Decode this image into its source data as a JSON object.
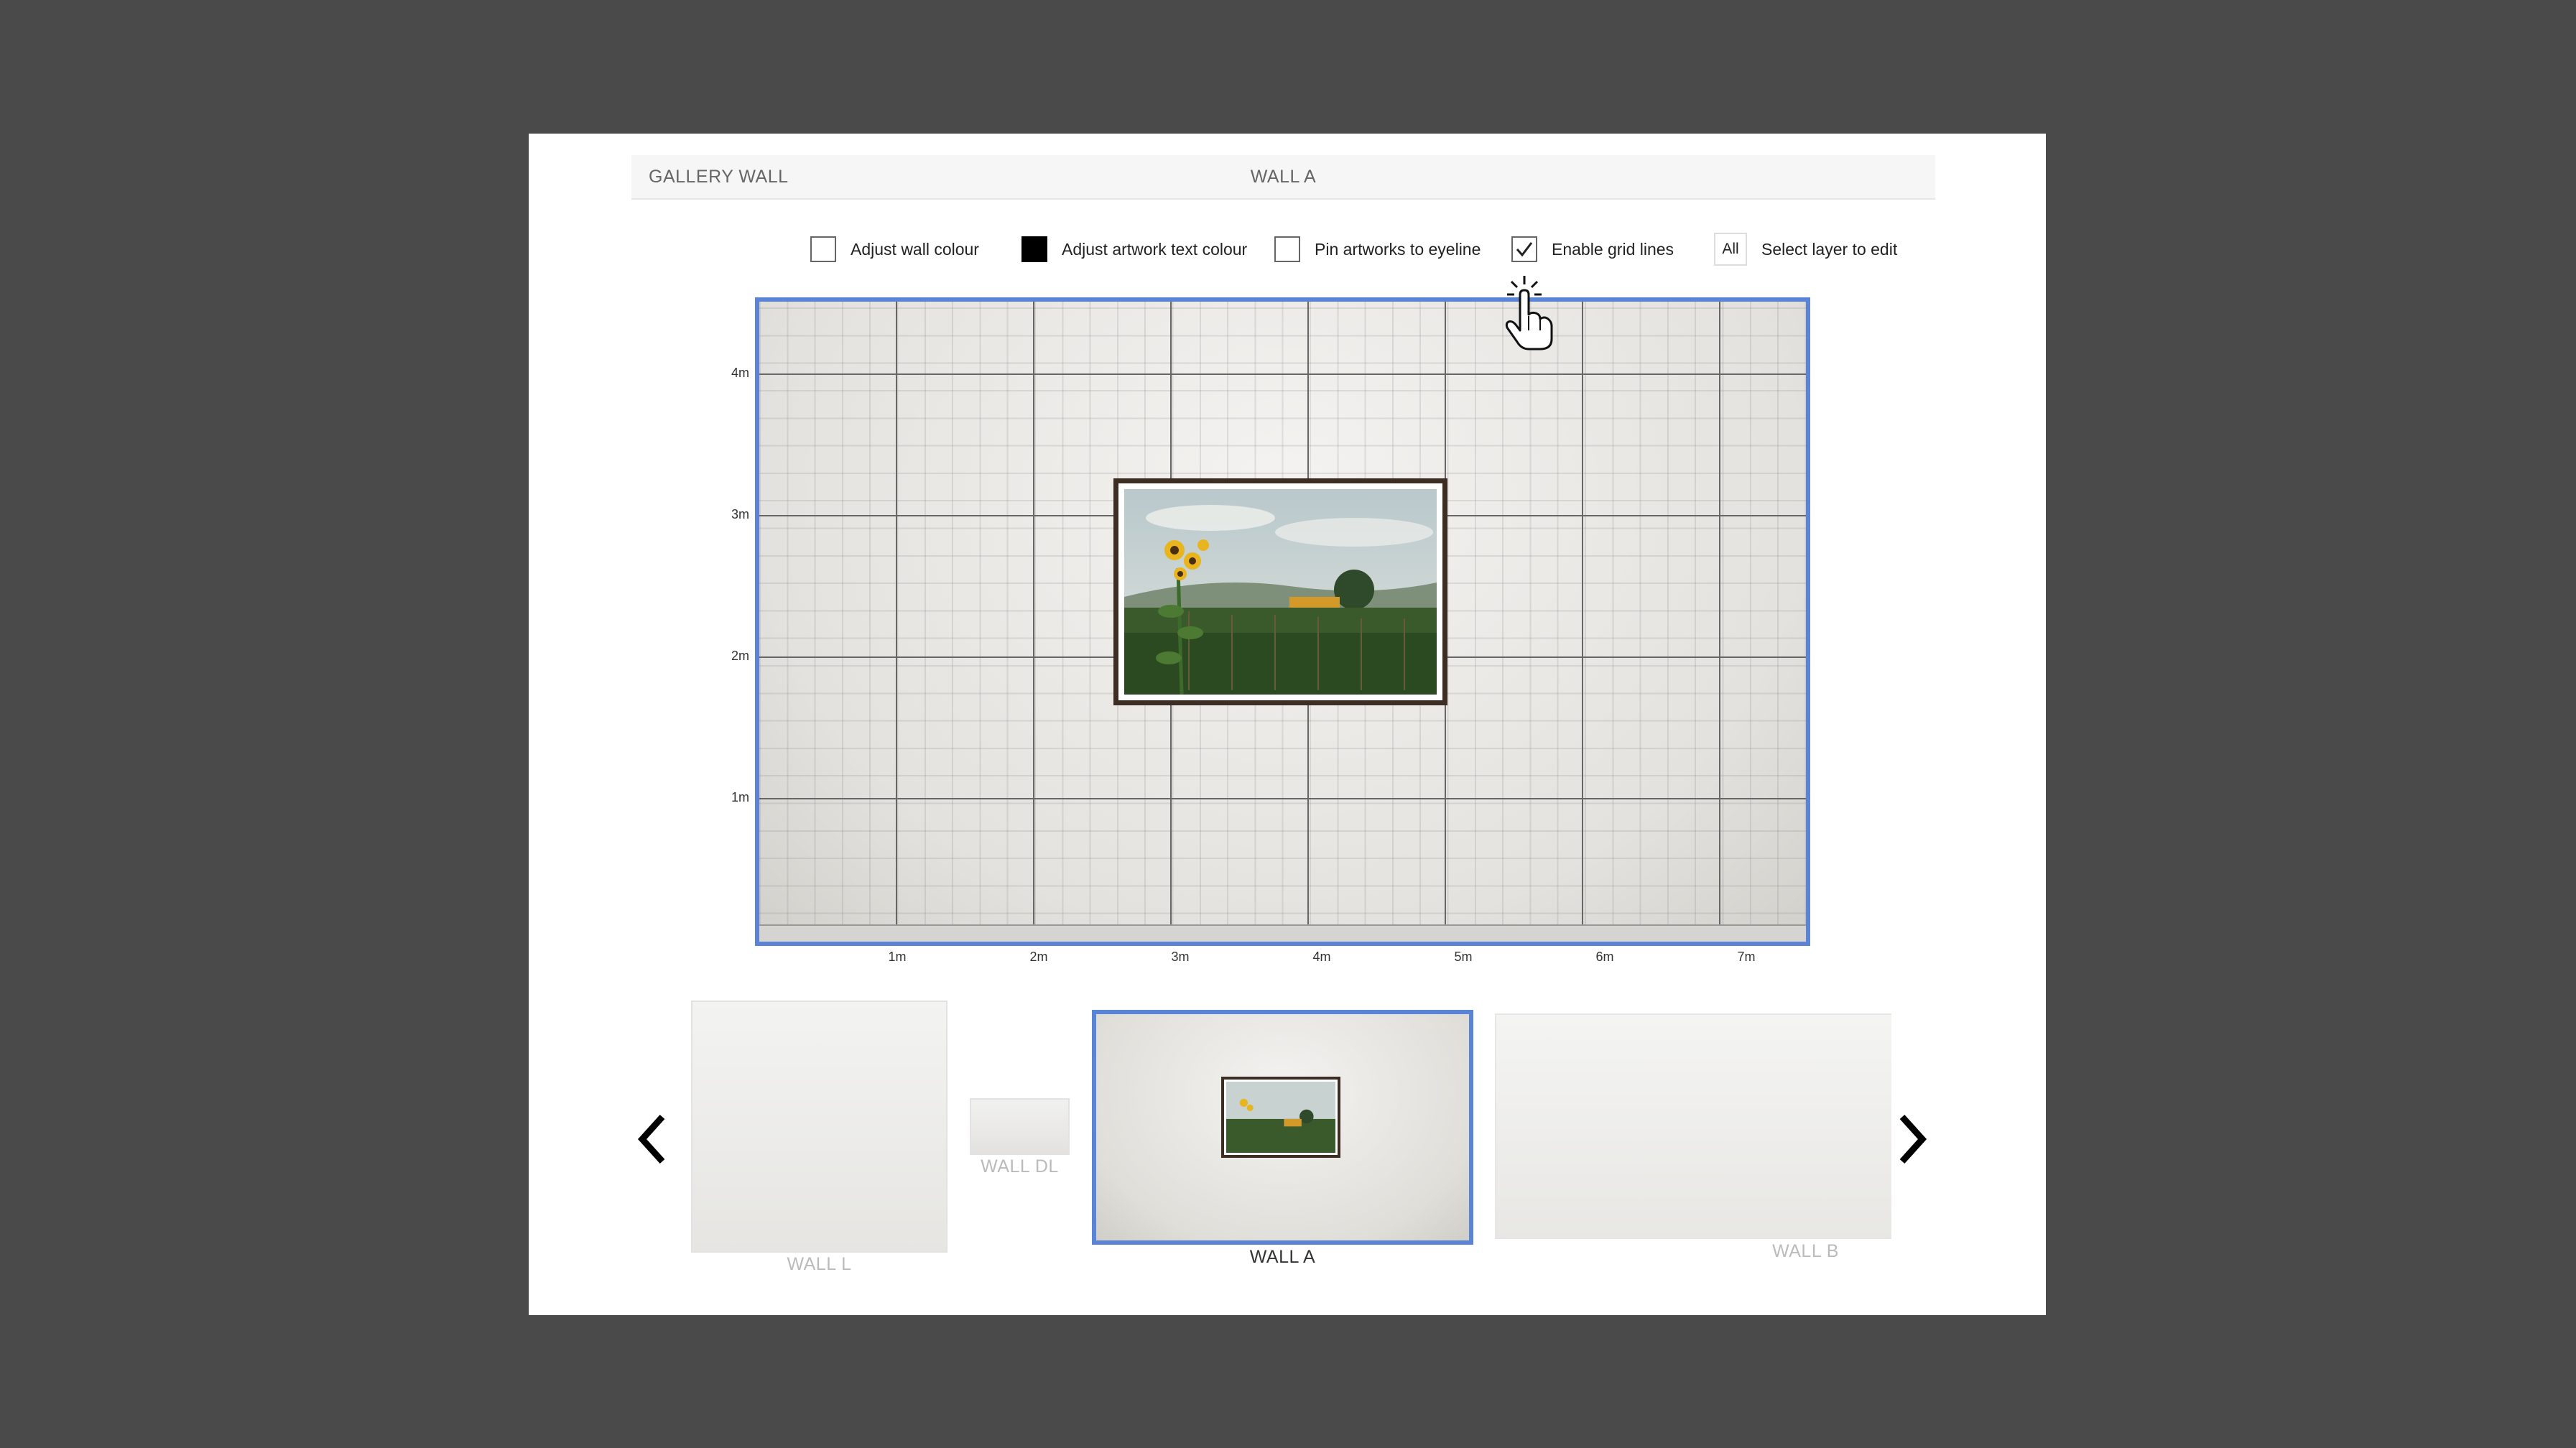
{
  "header": {
    "left_title": "GALLERY WALL",
    "center_title": "WALL A"
  },
  "options": {
    "adjust_wall_colour": {
      "label": "Adjust wall colour",
      "checked": false
    },
    "adjust_artwork_text_colour": {
      "label": "Adjust artwork text colour",
      "swatch": "#000000"
    },
    "pin_to_eyeline": {
      "label": "Pin artworks to eyeline",
      "checked": false
    },
    "enable_grid_lines": {
      "label": "Enable grid lines",
      "checked": true
    },
    "layer": {
      "value": "All",
      "label": "Select layer to edit"
    }
  },
  "wall": {
    "y_ticks": [
      "4m",
      "3m",
      "2m",
      "1m"
    ],
    "x_ticks": [
      "1m",
      "2m",
      "3m",
      "4m",
      "5m",
      "6m",
      "7m"
    ],
    "frame_color": "#5b84d6"
  },
  "artwork": {
    "subject": "sunflower field photograph",
    "frame_color": "#3e2d22"
  },
  "thumbnails": [
    {
      "label": "WALL L",
      "selected": false
    },
    {
      "label": "WALL DL",
      "selected": false
    },
    {
      "label": "WALL A",
      "selected": true
    },
    {
      "label": "WALL B",
      "selected": false
    }
  ],
  "icons": {
    "prev": "chevron-left-icon",
    "next": "chevron-right-icon",
    "cursor": "hand-pointer-icon"
  }
}
